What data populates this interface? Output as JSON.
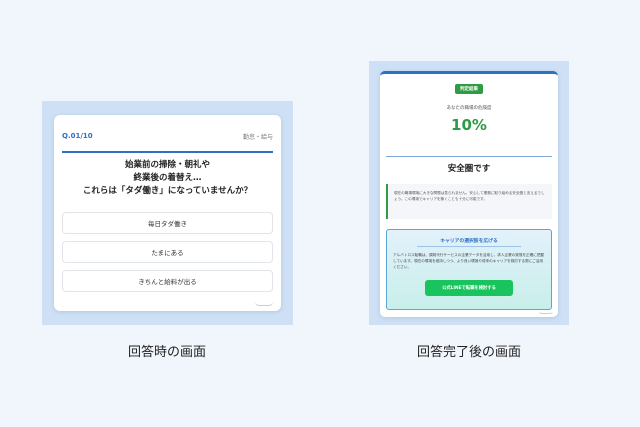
{
  "quiz": {
    "number": "Q.01/10",
    "category": "勤怠・給与",
    "question_lines": [
      "始業前の掃除・朝礼や",
      "終業後の着替え…",
      "これらは「タダ働き」になっていませんか？"
    ],
    "options": [
      "毎日タダ働き",
      "たまにある",
      "きちんと給料が出る"
    ]
  },
  "result": {
    "badge": "判定結果",
    "label": "あなたの職場の危険度",
    "percent": "10%",
    "status": "安全圏です",
    "comment": "現在の職場環境に大きな問題は見られません。安心して業務に取り組める安全圏と言えるでしょう。この環境でキャリアを築くことも十分に可能です。",
    "career": {
      "title": "キャリアの選択肢を広げる",
      "text": "アルバトロス転職は、調剤代行サービスの企業データを活用し、求人企業の実態を正確に把握しています。現在の環境を維持しつつ、より良い環境や将来のキャリアを検討する際にご活用ください。",
      "button": "公式LINEで転職を検討する"
    }
  },
  "captions": {
    "left": "回答時の画面",
    "right": "回答完了後の画面"
  },
  "colors": {
    "accent": "#2f6fc4",
    "safe": "#2e9b45",
    "line_button": "#19c35d",
    "panel": "#cde0f5",
    "background": "#f1f6fc"
  }
}
